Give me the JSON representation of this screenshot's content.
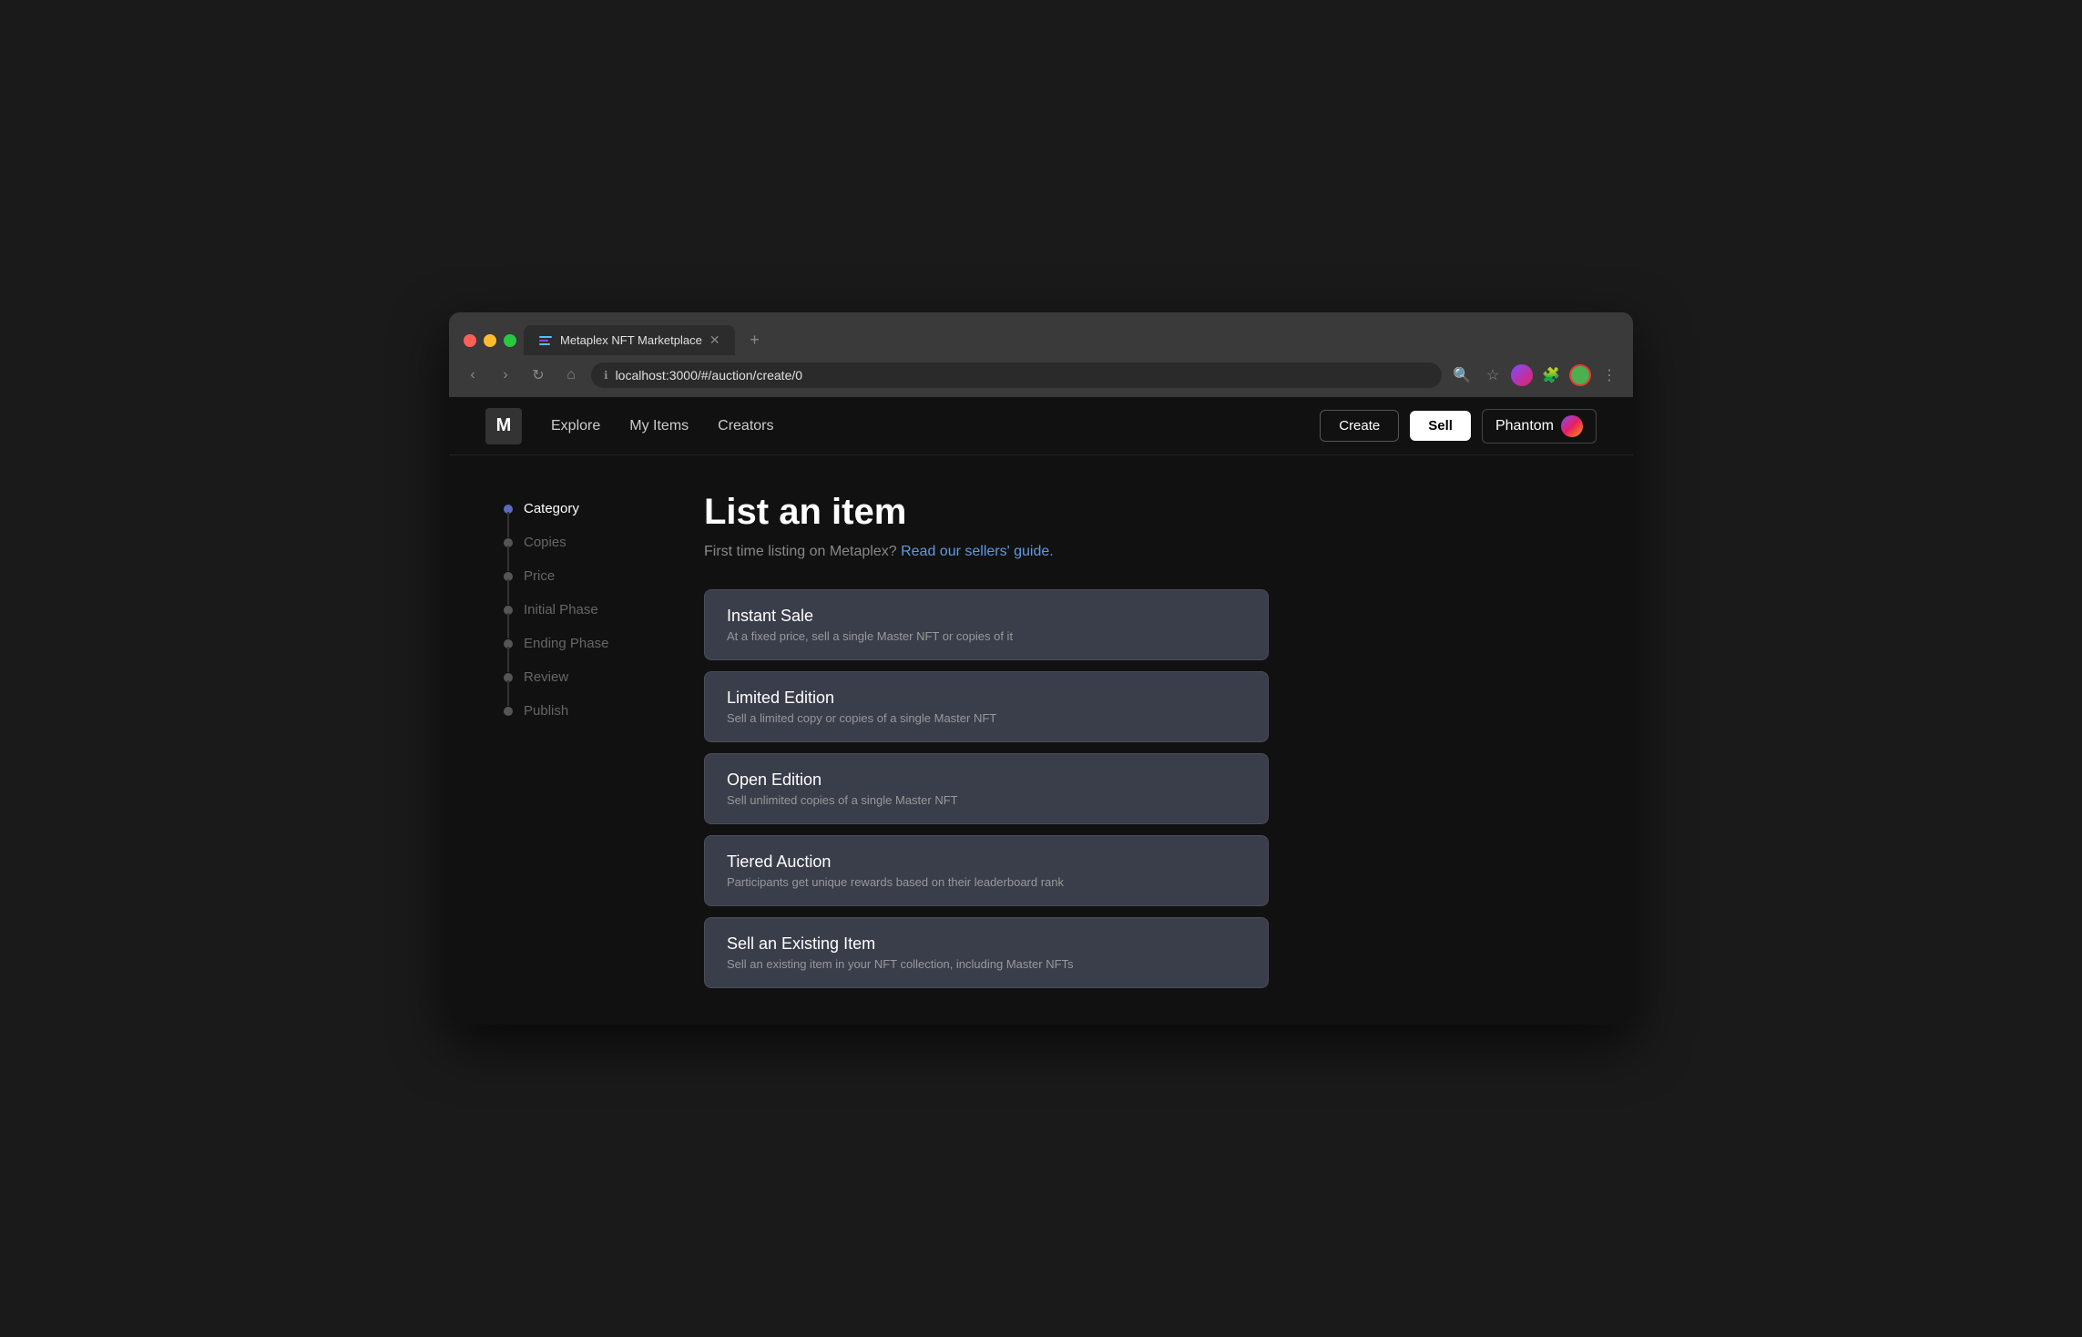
{
  "browser": {
    "tab_title": "Metaplex NFT Marketplace",
    "address": "localhost:3000/#/auction/create/0",
    "tab_new_label": "+",
    "nav_back": "‹",
    "nav_forward": "›",
    "nav_refresh": "↻",
    "nav_home": "⌂",
    "nav_search": "🔍",
    "nav_star": "☆",
    "nav_more": "⋮"
  },
  "nav": {
    "logo": "M",
    "links": [
      {
        "id": "explore",
        "label": "Explore"
      },
      {
        "id": "my-items",
        "label": "My Items"
      },
      {
        "id": "creators",
        "label": "Creators"
      }
    ],
    "create_label": "Create",
    "sell_label": "Sell",
    "phantom_label": "Phantom"
  },
  "page": {
    "title": "List an item",
    "subtitle_static": "First time listing on Metaplex?",
    "subtitle_link": "Read our sellers' guide."
  },
  "sidebar": {
    "items": [
      {
        "id": "category",
        "label": "Category",
        "active": true
      },
      {
        "id": "copies",
        "label": "Copies",
        "active": false
      },
      {
        "id": "price",
        "label": "Price",
        "active": false
      },
      {
        "id": "initial-phase",
        "label": "Initial Phase",
        "active": false
      },
      {
        "id": "ending-phase",
        "label": "Ending Phase",
        "active": false
      },
      {
        "id": "review",
        "label": "Review",
        "active": false
      },
      {
        "id": "publish",
        "label": "Publish",
        "active": false
      }
    ]
  },
  "categories": [
    {
      "id": "instant-sale",
      "title": "Instant Sale",
      "description": "At a fixed price, sell a single Master NFT or copies of it"
    },
    {
      "id": "limited-edition",
      "title": "Limited Edition",
      "description": "Sell a limited copy or copies of a single Master NFT"
    },
    {
      "id": "open-edition",
      "title": "Open Edition",
      "description": "Sell unlimited copies of a single Master NFT"
    },
    {
      "id": "tiered-auction",
      "title": "Tiered Auction",
      "description": "Participants get unique rewards based on their leaderboard rank"
    },
    {
      "id": "sell-existing",
      "title": "Sell an Existing Item",
      "description": "Sell an existing item in your NFT collection, including Master NFTs"
    }
  ]
}
